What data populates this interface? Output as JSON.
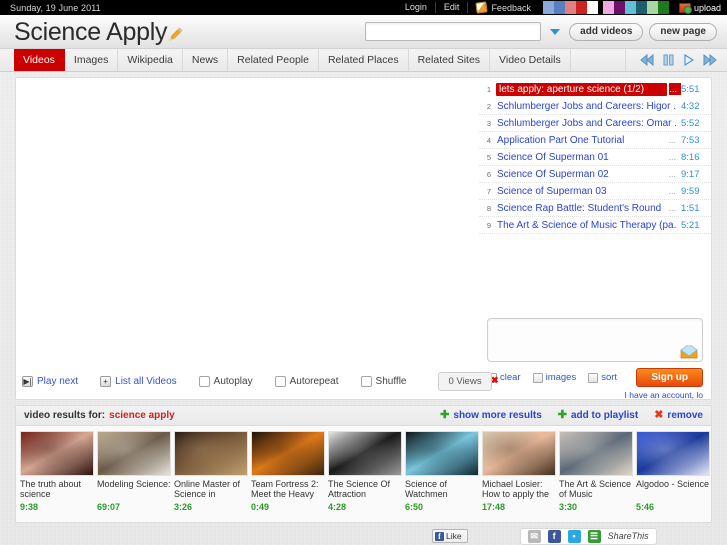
{
  "topbar": {
    "date": "Sunday, 19 June 2011",
    "login": "Login",
    "edit": "Edit",
    "feedback": "Feedback",
    "upload": "upload",
    "swatches": [
      "#8aa9d6",
      "#5a7fc0",
      "#e08080",
      "#cc2222",
      "#ffffff",
      "#000000",
      "#f0a8e0",
      "#6b0f6b",
      "#5fc0d8",
      "#1b5f6b",
      "#a8d8a0",
      "#1e7a1e"
    ]
  },
  "header": {
    "brand": "Science Apply",
    "search_value": "",
    "search_placeholder": "",
    "add_videos": "add videos",
    "new_page": "new page"
  },
  "tabs": [
    {
      "label": "Videos",
      "active": true
    },
    {
      "label": "Images",
      "active": false
    },
    {
      "label": "Wikipedia",
      "active": false
    },
    {
      "label": "News",
      "active": false
    },
    {
      "label": "Related People",
      "active": false
    },
    {
      "label": "Related Places",
      "active": false
    },
    {
      "label": "Related Sites",
      "active": false
    },
    {
      "label": "Video Details",
      "active": false
    }
  ],
  "player_controls": [
    {
      "name": "rewind-button",
      "glyph": "◀◀"
    },
    {
      "name": "pause-button",
      "glyph": "‖"
    },
    {
      "name": "play-button",
      "glyph": "▶"
    },
    {
      "name": "fast-forward-button",
      "glyph": "▶▶"
    }
  ],
  "playlist": [
    {
      "n": "1",
      "title": "lets apply: aperture science (1/2)",
      "dots": "...",
      "time": "5:51",
      "selected": true
    },
    {
      "n": "2",
      "title": "Schlumberger Jobs and Careers: Higor ...",
      "dots": "",
      "time": "4:32",
      "selected": false
    },
    {
      "n": "3",
      "title": "Schlumberger Jobs and Careers: Omar ...",
      "dots": "",
      "time": "5:52",
      "selected": false
    },
    {
      "n": "4",
      "title": "Application Part One Tutorial",
      "dots": "...",
      "time": "7:53",
      "selected": false
    },
    {
      "n": "5",
      "title": "Science Of Superman 01",
      "dots": "...",
      "time": "8:16",
      "selected": false
    },
    {
      "n": "6",
      "title": "Science Of Superman 02",
      "dots": "...",
      "time": "9:17",
      "selected": false
    },
    {
      "n": "7",
      "title": "Science of Superman 03",
      "dots": "...",
      "time": "9:59",
      "selected": false
    },
    {
      "n": "8",
      "title": "Science Rap Battle: Student's Round",
      "dots": "...",
      "time": "1:51",
      "selected": false
    },
    {
      "n": "9",
      "title": "The Art & Science of Music Therapy (pa...",
      "dots": "",
      "time": "5:21",
      "selected": false
    }
  ],
  "comment": {
    "value": "",
    "placeholder": "",
    "clear": "clear",
    "images": "images",
    "sort": "sort",
    "signup": "Sign up",
    "account_line": "I have an account, lo"
  },
  "controls": {
    "play_next": "Play next",
    "list_all": "List all Videos",
    "autoplay": "Autoplay",
    "autorepeat": "Autorepeat",
    "shuffle": "Shuffle",
    "views": "0 Views"
  },
  "results": {
    "label": "video results for:",
    "query": "science apply",
    "show_more": "show more results",
    "add_to_playlist": "add to playlist",
    "remove": "remove",
    "items": [
      {
        "title": "The truth about science",
        "duration": "9:38",
        "c1": "#7a2018",
        "c2": "#d8a894",
        "c3": "#2a1410"
      },
      {
        "title": "Modeling Science:",
        "duration": "69:07",
        "c1": "#b9a98c",
        "c2": "#6a5a48",
        "c3": "#e8e4dc"
      },
      {
        "title": "Online Master of Science in",
        "duration": "3:26",
        "c1": "#2b1a14",
        "c2": "#7a5a3a",
        "c3": "#c0a070"
      },
      {
        "title": "Team Fortress 2: Meet the Heavy",
        "duration": "0:49",
        "c1": "#1a1008",
        "c2": "#e07a18",
        "c3": "#3a2410"
      },
      {
        "title": "The Science Of Attraction",
        "duration": "4:28",
        "c1": "#e8e8e8",
        "c2": "#1a1a1a",
        "c3": "#9a9a9a"
      },
      {
        "title": "Science of Watchmen",
        "duration": "6:50",
        "c1": "#0a1418",
        "c2": "#7ac8e0",
        "c3": "#102830"
      },
      {
        "title": "Michael Losier: How to apply the",
        "duration": "17:48",
        "c1": "#d8c8b0",
        "c2": "#e8b898",
        "c3": "#403020"
      },
      {
        "title": "The Art & Science of Music",
        "duration": "3:30",
        "c1": "#c8c0b8",
        "c2": "#5a6878",
        "c3": "#e0d8c8"
      },
      {
        "title": "Algodoo - Science",
        "duration": "5:46",
        "c1": "#3a5ad8",
        "c2": "#1a3a9a",
        "c3": "#e8e8f8"
      }
    ]
  },
  "social": {
    "like": "Like",
    "fb_glyph": "f",
    "share_this": "ShareThis",
    "icons": [
      {
        "name": "email-share-icon",
        "glyph": "✉",
        "color": "#b8b8b8"
      },
      {
        "name": "facebook-share-icon",
        "glyph": "f",
        "color": "#3b5998"
      },
      {
        "name": "twitter-share-icon",
        "glyph": "•",
        "color": "#2aa9e0"
      },
      {
        "name": "sharethis-icon",
        "glyph": "☰",
        "color": "#3a9a3a"
      }
    ]
  }
}
